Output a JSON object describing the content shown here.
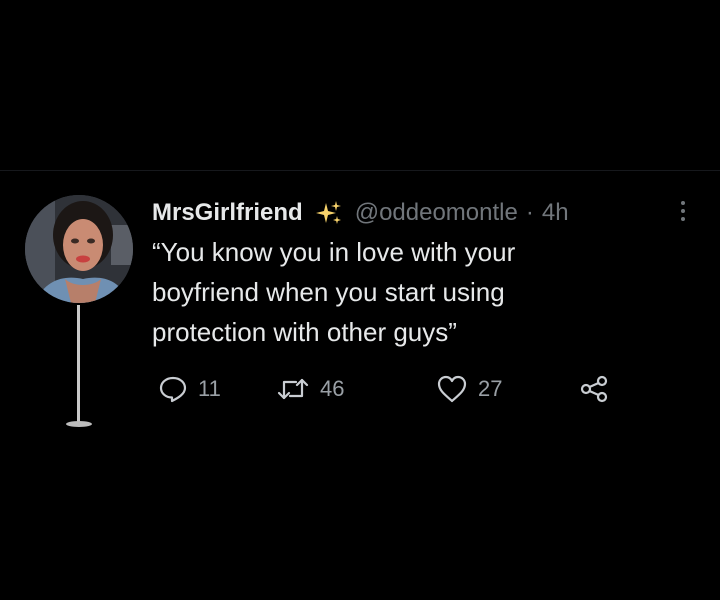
{
  "tweet": {
    "display_name": "MrsGirlfriend",
    "handle": "@oddeomontle",
    "separator": "·",
    "time": "4h",
    "text_lines": [
      "“You know you in love with your",
      "boyfriend when you start using",
      "protection with other guys”"
    ],
    "icons": {
      "badge": "sparkles-icon",
      "more": "more-vertical-icon",
      "reply": "reply-icon",
      "retweet": "retweet-icon",
      "like": "heart-icon",
      "share": "share-icon"
    },
    "stats": {
      "replies": "11",
      "retweets": "46",
      "likes": "27"
    }
  },
  "colors": {
    "background": "#000000",
    "text": "#e7e9ea",
    "muted": "#71767b",
    "sparkle": "#f7d26b"
  }
}
